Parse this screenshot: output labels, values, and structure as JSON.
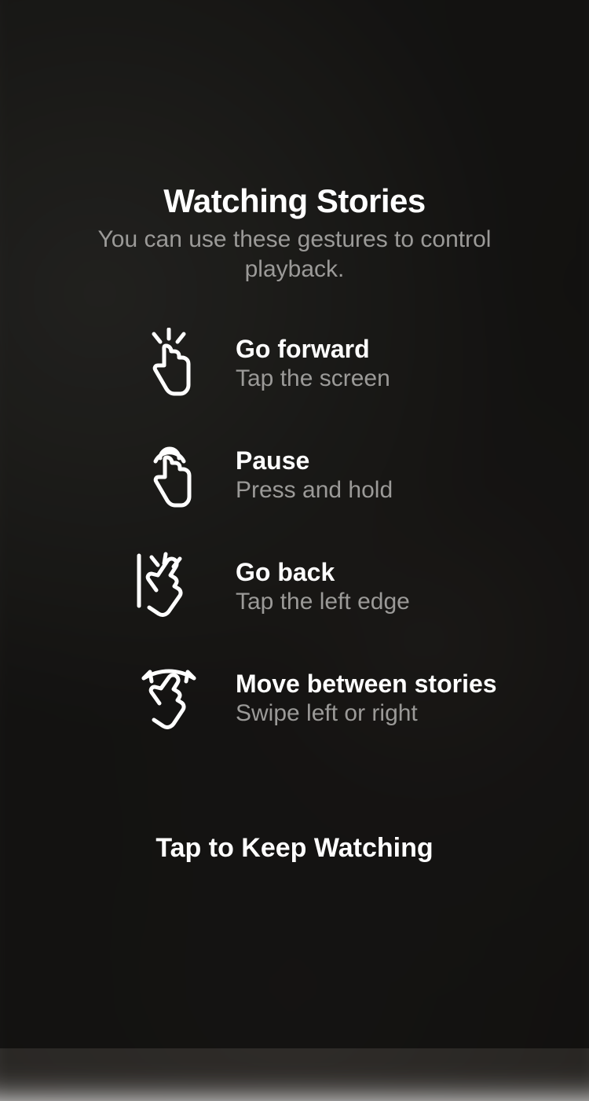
{
  "header": {
    "title": "Watching Stories",
    "subtitle": "You can use these gestures to control playback."
  },
  "items": [
    {
      "title": "Go forward",
      "desc": "Tap the screen"
    },
    {
      "title": "Pause",
      "desc": "Press and hold"
    },
    {
      "title": "Go back",
      "desc": "Tap the left edge"
    },
    {
      "title": "Move between stories",
      "desc": "Swipe left or right"
    }
  ],
  "cta": "Tap to Keep Watching"
}
